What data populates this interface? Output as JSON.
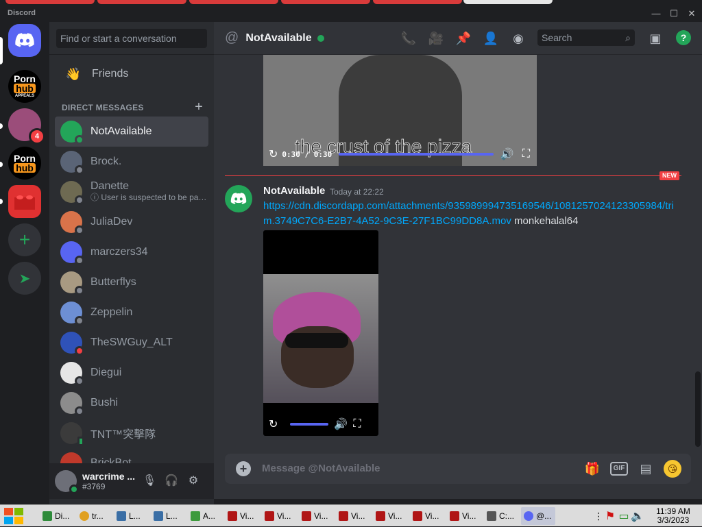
{
  "window": {
    "app_title": "Discord",
    "controls": [
      "—",
      "☐",
      "✕"
    ]
  },
  "servers": [
    {
      "name": "Direct Messages",
      "icon": "discord-logo-icon"
    },
    {
      "name": "Porn hub Appeals",
      "line1": "Porn",
      "line2": "hub",
      "line3": "APPEALS"
    },
    {
      "name": "server-with-badge",
      "badge": "4"
    },
    {
      "name": "Porn hub",
      "line1": "Porn",
      "line2": "hub"
    },
    {
      "name": "red-block-server"
    },
    {
      "name": "add-server",
      "glyph": "+"
    },
    {
      "name": "explore",
      "glyph": "➤"
    }
  ],
  "sidebar": {
    "search_placeholder": "Find or start a conversation",
    "friends_label": "Friends",
    "dm_header": "DIRECT MESSAGES",
    "dm_add": "+",
    "dms": [
      {
        "name": "NotAvailable",
        "status": "online",
        "active": true,
        "avatar_color": "#23a559"
      },
      {
        "name": "Brock.",
        "status": "offline",
        "avatar_color": "#5a6476"
      },
      {
        "name": "Danette",
        "sub": "ⓘ User is suspected to be par...",
        "status": "offline",
        "avatar_color": "#6e6a52"
      },
      {
        "name": "JuliaDev",
        "status": "offline",
        "avatar_color": "#d9734a"
      },
      {
        "name": "marczers34",
        "status": "offline",
        "avatar_color": "#5865f2"
      },
      {
        "name": "Butterflys",
        "status": "offline",
        "avatar_color": "#a89a82"
      },
      {
        "name": "Zeppelin",
        "status": "offline",
        "avatar_color": "#6d8fd4"
      },
      {
        "name": "TheSWGuy_ALT",
        "status": "dnd",
        "avatar_color": "#2f52b8"
      },
      {
        "name": "Diegui",
        "status": "offline",
        "avatar_color": "#e6e6e6"
      },
      {
        "name": "Bushi",
        "status": "offline",
        "avatar_color": "#8c8c8c"
      },
      {
        "name": "TNT™突擊隊",
        "status": "mobile",
        "avatar_color": "#3b3b3b"
      },
      {
        "name": "BrickBot",
        "status": "offline",
        "avatar_color": "#c0392b"
      }
    ]
  },
  "user_panel": {
    "username": "warcrime ...",
    "tag": "#3769"
  },
  "header": {
    "channel": "NotAvailable",
    "search_placeholder": "Search",
    "icons": [
      "phone-call-icon",
      "video-call-icon",
      "pin-icon",
      "add-friend-icon",
      "profile-icon",
      "inbox-icon",
      "help-icon"
    ]
  },
  "messages": {
    "video1_caption": "the crust of the pizza",
    "video1_time": "0:30 / 0:30",
    "new_tag": "NEW",
    "author": "NotAvailable",
    "timestamp": "Today at 22:22",
    "link": "https://cdn.discordapp.com/attachments/935989994735169546/1081257024123305984/trim.3749C7C6-E2B7-4A52-9C3E-27F1BC99DD8A.mov",
    "after_link": " monkehalal64"
  },
  "composer": {
    "placeholder": "Message @NotAvailable",
    "gif_label": "GIF"
  },
  "taskbar": {
    "items": [
      {
        "label": "Di...",
        "color": "#2e8b3a"
      },
      {
        "label": "tr...",
        "color": "#e0a020"
      },
      {
        "label": "L...",
        "color": "#3a6ea5"
      },
      {
        "label": "L...",
        "color": "#3a6ea5"
      },
      {
        "label": "A...",
        "color": "#3c9a3c"
      },
      {
        "label": "Vi...",
        "color": "#b01515"
      },
      {
        "label": "Vi...",
        "color": "#b01515"
      },
      {
        "label": "Vi...",
        "color": "#b01515"
      },
      {
        "label": "Vi...",
        "color": "#b01515"
      },
      {
        "label": "Vi...",
        "color": "#b01515"
      },
      {
        "label": "Vi...",
        "color": "#b01515"
      },
      {
        "label": "Vi...",
        "color": "#b01515"
      },
      {
        "label": "C:...",
        "color": "#555555"
      },
      {
        "label": "@...",
        "color": "#5865f2"
      }
    ],
    "time": "11:39 AM",
    "date": "3/3/2023"
  },
  "colors": {
    "blurple": "#5865f2",
    "online": "#23a559",
    "dnd": "#f23f43",
    "link": "#00a8fc"
  }
}
